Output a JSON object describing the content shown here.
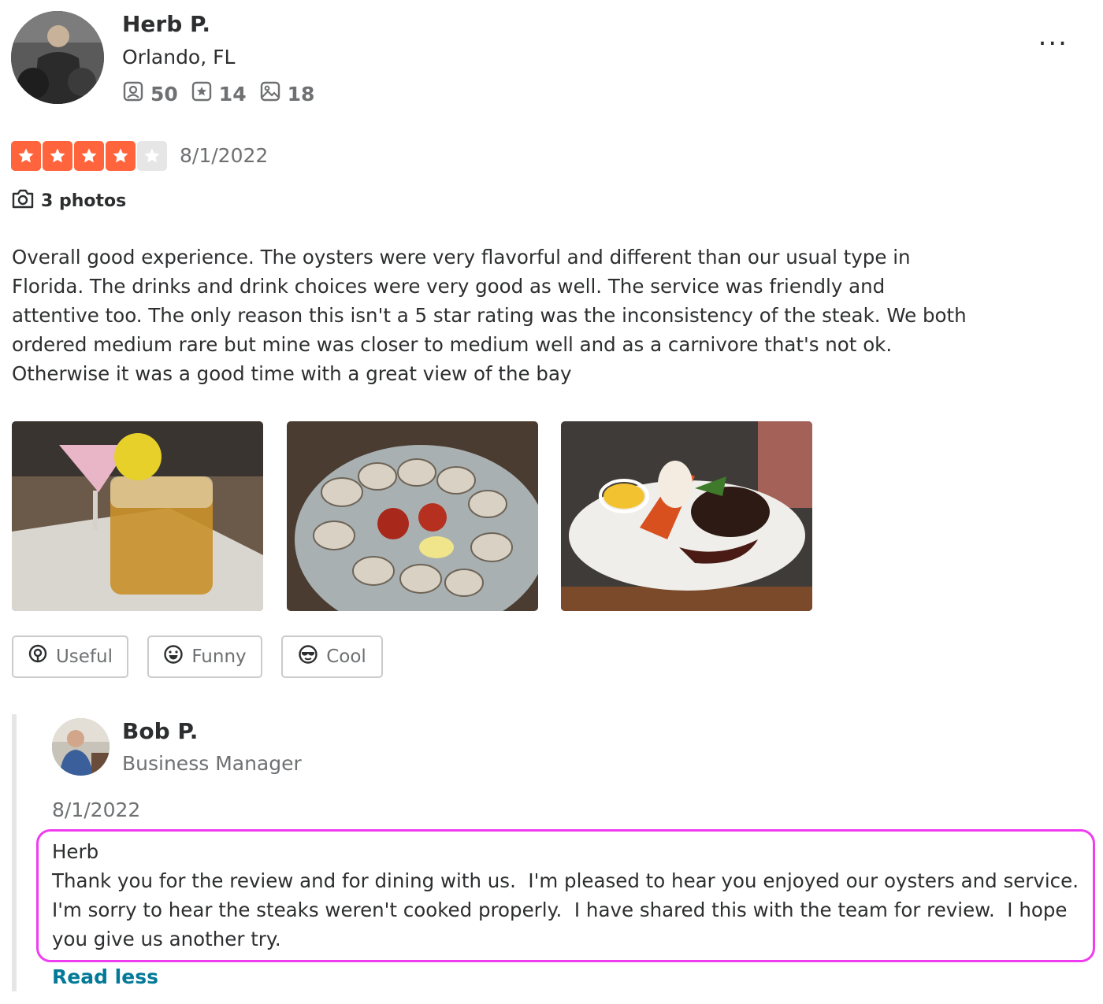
{
  "reviewer": {
    "name": "Herb P.",
    "location": "Orlando, FL",
    "friends": "50",
    "reviews": "14",
    "photos": "18"
  },
  "more_menu": "...",
  "rating": {
    "stars": 4,
    "max": 5,
    "date": "8/1/2022",
    "color": "#ff643d",
    "empty_color": "#e6e6e6"
  },
  "photos_link": "3 photos",
  "review_text": "Overall good experience. The oysters were very flavorful and different than our usual type in Florida. The drinks and drink choices were very good as well. The service was friendly and attentive too. The only reason this isn't a 5 star rating was the inconsistency of the steak. We both ordered medium rare but mine was closer to medium well and as a carnivore that's not ok. Otherwise it was a good time with a great view of the bay",
  "photo_items": [
    {
      "icon": "cocktail-photo"
    },
    {
      "icon": "oysters-photo"
    },
    {
      "icon": "steak-lobster-photo"
    }
  ],
  "reactions": {
    "useful": "Useful",
    "funny": "Funny",
    "cool": "Cool"
  },
  "owner_reply": {
    "name": "Bob P.",
    "role": "Business Manager",
    "date": "8/1/2022",
    "greeting": "Herb",
    "body": "Thank you for the review and for dining with us.  I'm pleased to hear you enjoyed our oysters and service.  I'm sorry to hear the steaks weren't cooked properly.  I have shared this with the team for review.  I hope you give us another try.",
    "highlight_color": "#f03cf0"
  },
  "read_less": "Read less",
  "link_color": "#027a97"
}
